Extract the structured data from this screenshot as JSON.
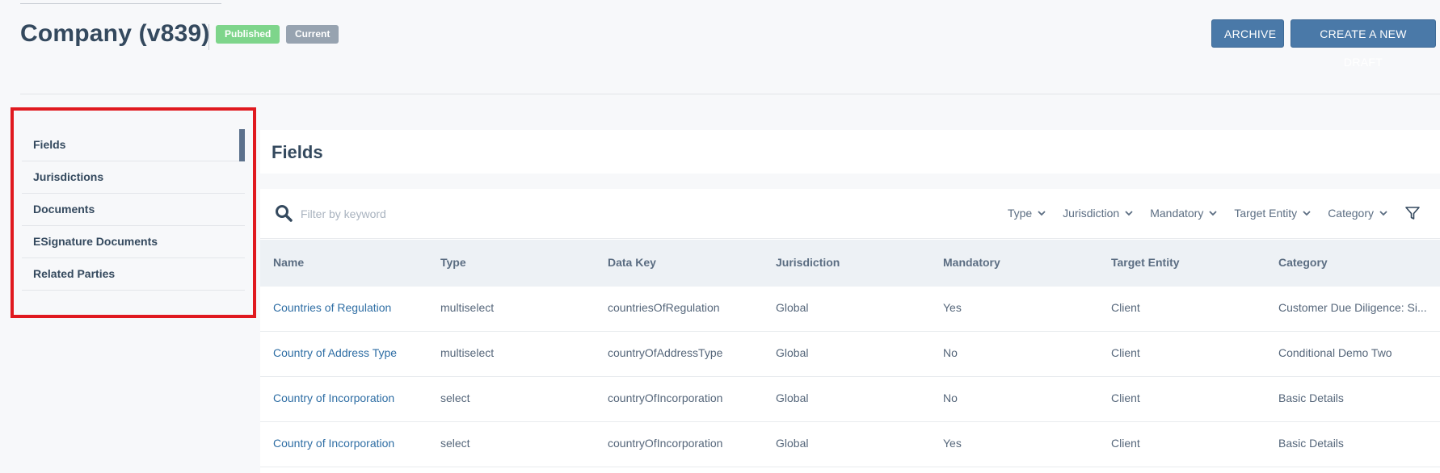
{
  "header": {
    "title": "Company (v839)",
    "badges": {
      "published": "Published",
      "current": "Current"
    },
    "buttons": {
      "archive": "ARCHIVE",
      "create_draft": "CREATE A NEW DRAFT"
    }
  },
  "sidebar": {
    "items": [
      {
        "label": "Fields",
        "active": true
      },
      {
        "label": "Jurisdictions"
      },
      {
        "label": "Documents"
      },
      {
        "label": "ESignature Documents"
      },
      {
        "label": "Related Parties"
      }
    ]
  },
  "main": {
    "title": "Fields",
    "search": {
      "placeholder": "Filter by keyword",
      "icon": "search-icon"
    },
    "filters": [
      "Type",
      "Jurisdiction",
      "Mandatory",
      "Target Entity",
      "Category"
    ],
    "filter_icon": "funnel-icon",
    "table": {
      "columns": [
        "Name",
        "Type",
        "Data Key",
        "Jurisdiction",
        "Mandatory",
        "Target Entity",
        "Category"
      ],
      "rows": [
        [
          "Countries of Regulation",
          "multiselect",
          "countriesOfRegulation",
          "Global",
          "Yes",
          "Client",
          "Customer Due Diligence: Si..."
        ],
        [
          "Country of Address Type",
          "multiselect",
          "countryOfAddressType",
          "Global",
          "No",
          "Client",
          "Conditional Demo Two"
        ],
        [
          "Country of Incorporation",
          "select",
          "countryOfIncorporation",
          "Global",
          "No",
          "Client",
          "Basic Details"
        ],
        [
          "Country of Incorporation",
          "select",
          "countryOfIncorporation",
          "Global",
          "Yes",
          "Client",
          "Basic Details"
        ]
      ]
    }
  },
  "colors": {
    "primary_button": "#4a79a8",
    "published_badge": "#7ed58b",
    "current_badge": "#97a3b0",
    "link": "#2f6ea4",
    "highlight_box": "#e0191f"
  }
}
